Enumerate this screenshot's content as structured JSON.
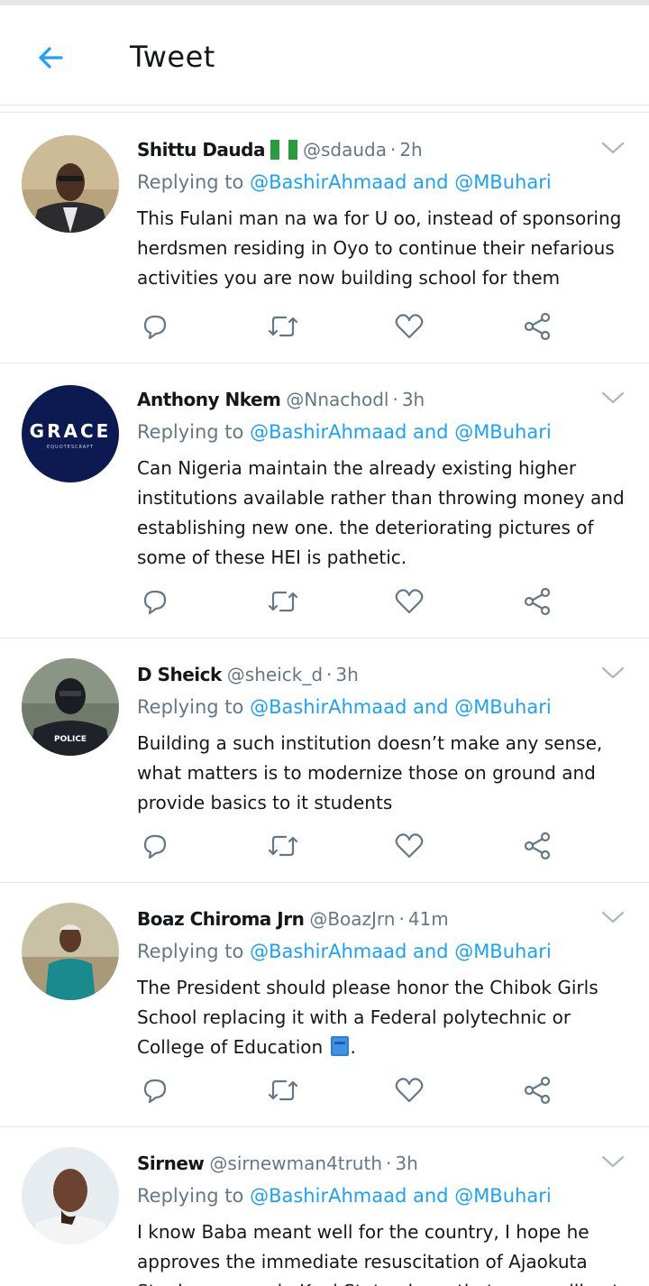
{
  "header": {
    "title": "Tweet"
  },
  "tweets": [
    {
      "name": "Shittu Dauda",
      "handle": "@sdauda",
      "time": "2h",
      "replying_prefix": "Replying to",
      "replying_to_1": "@BashirAhmaad",
      "replying_and": "and",
      "replying_to_2": "@MBuhari",
      "text": "This Fulani man na wa for U oo, instead of sponsoring herdsmen residing in Oyo to continue their nefarious activities you are now building school for them"
    },
    {
      "name": "Anthony Nkem",
      "handle": "@Nnachodl",
      "time": "3h",
      "avatar_text": "GRACE",
      "avatar_subtext": "EQUOTESCRAFT",
      "replying_prefix": "Replying to",
      "replying_to_1": "@BashirAhmaad",
      "replying_and": "and",
      "replying_to_2": "@MBuhari",
      "text": "Can Nigeria maintain the already existing  higher institutions available rather than throwing money and establishing new one. the deteriorating pictures of some of these HEI is pathetic."
    },
    {
      "name": "D Sheick",
      "handle": "@sheick_d",
      "time": "3h",
      "avatar_text": "POLICE",
      "replying_prefix": "Replying to",
      "replying_to_1": "@BashirAhmaad",
      "replying_and": "and",
      "replying_to_2": "@MBuhari",
      "text": "Building a such institution doesn’t make any sense, what matters is to modernize those on ground and provide basics to it students"
    },
    {
      "name": "Boaz Chiroma Jrn",
      "handle": "@BoazJrn",
      "time": "41m",
      "replying_prefix": "Replying to",
      "replying_to_1": "@BashirAhmaad",
      "replying_and": "and",
      "replying_to_2": "@MBuhari",
      "text": "The President should please honor the Chibok Girls School replacing it with a Federal polytechnic or College of Education",
      "text_suffix": "."
    },
    {
      "name": "Sirnew",
      "handle": "@sirnewman4truth",
      "time": "3h",
      "replying_prefix": "Replying to",
      "replying_to_1": "@BashirAhmaad",
      "replying_and": "and",
      "replying_to_2": "@MBuhari",
      "text": "I know Baba meant well for the country, I hope he approves the immediate resuscitation of Ajaokuta Steel company in Kogi State oh, so that some will not think"
    }
  ],
  "separator": "·",
  "icons": {
    "back": "arrow-left-icon",
    "reply": "reply-bubble-icon",
    "retweet": "retweet-icon",
    "like": "heart-icon",
    "share": "share-icon",
    "more": "chevron-down-icon",
    "flag": "nigeria-flag-icon",
    "book": "blue-book-emoji"
  },
  "colors": {
    "accent": "#1da1f2",
    "secondary_text": "#657786",
    "icon_gray": "#657786",
    "divider": "#e1e8ed"
  }
}
